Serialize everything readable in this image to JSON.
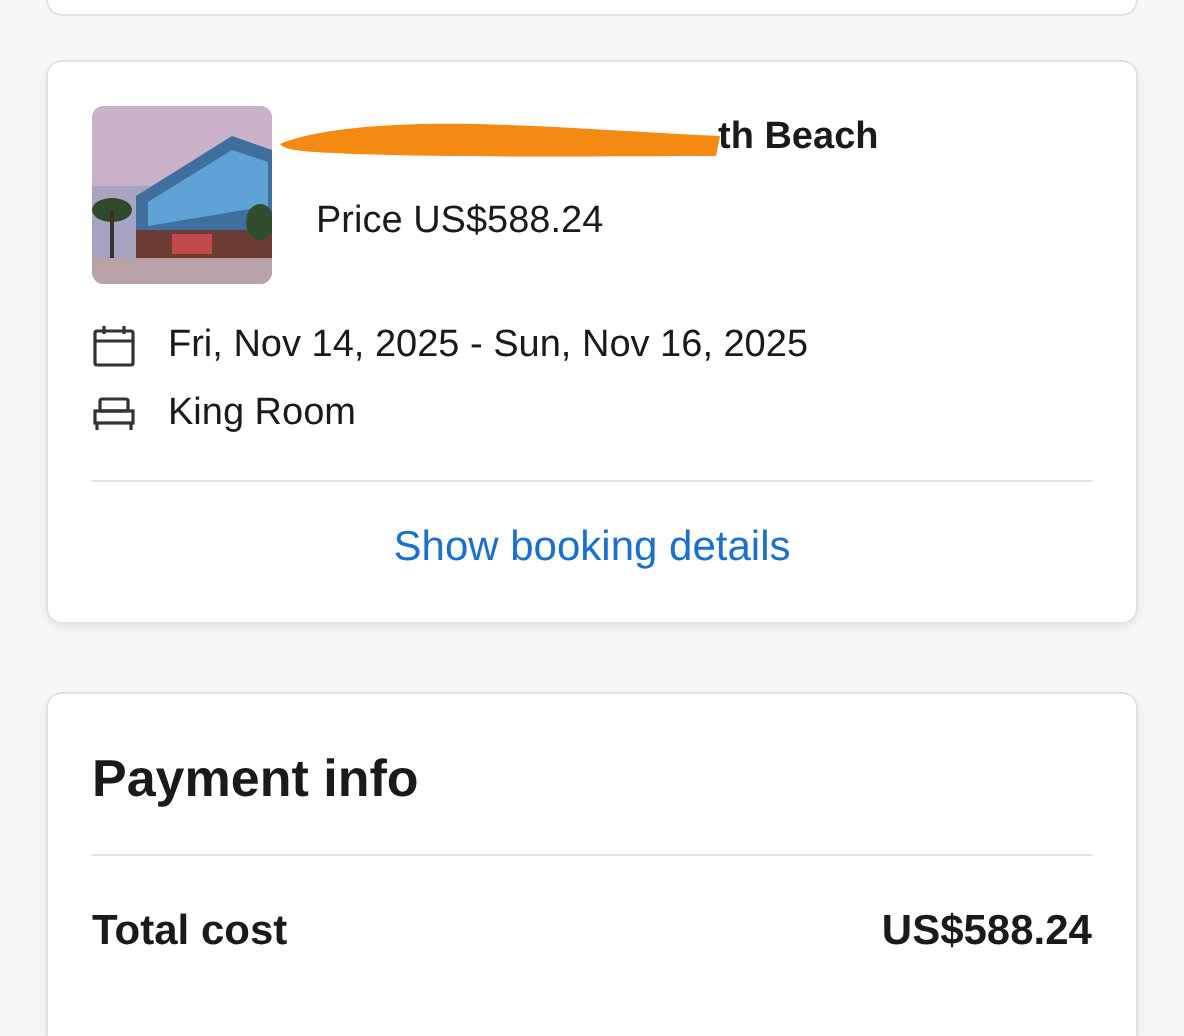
{
  "booking": {
    "hotel_name": "th Beach",
    "price": "Price US$588.24",
    "dates": "Fri, Nov 14, 2025 - Sun, Nov 16, 2025",
    "room": "King Room",
    "details_link": "Show booking details"
  },
  "payment_info": {
    "title": "Payment info",
    "rows": [
      {
        "label": "Total cost",
        "value": "US$588.24"
      }
    ]
  }
}
